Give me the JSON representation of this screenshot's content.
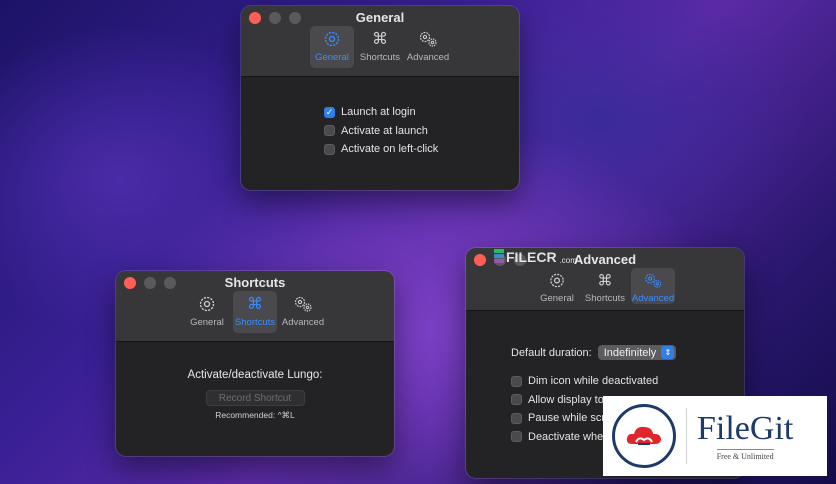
{
  "general_window": {
    "title": "General",
    "tabs": [
      "General",
      "Shortcuts",
      "Advanced"
    ],
    "options": [
      {
        "label": "Launch at login",
        "checked": true
      },
      {
        "label": "Activate at launch",
        "checked": false
      },
      {
        "label": "Activate on left-click",
        "checked": false
      }
    ]
  },
  "shortcuts_window": {
    "title": "Shortcuts",
    "tabs": [
      "General",
      "Shortcuts",
      "Advanced"
    ],
    "heading": "Activate/deactivate Lungo:",
    "record_button": "Record Shortcut",
    "recommended": "Recommended: ^⌘L"
  },
  "advanced_window": {
    "title": "Advanced",
    "tabs": [
      "General",
      "Shortcuts",
      "Advanced"
    ],
    "duration_label": "Default duration:",
    "duration_value": "Indefinitely",
    "options": [
      {
        "label": "Dim icon while deactivated",
        "checked": false
      },
      {
        "label": "Allow display to s",
        "checked": false
      },
      {
        "label": "Pause while scre",
        "checked": false
      },
      {
        "label": "Deactivate when",
        "checked": false
      }
    ]
  },
  "watermark": {
    "text": "FILECR",
    "suffix": ".com"
  },
  "filegit_logo": {
    "title": "FileGit",
    "subtitle": "Free & Unlimited"
  },
  "colors": {
    "accent": "#2f7fe8",
    "close_light": "#ff5f57",
    "window_bg": "#232325",
    "titlebar_bg": "#37373a"
  }
}
